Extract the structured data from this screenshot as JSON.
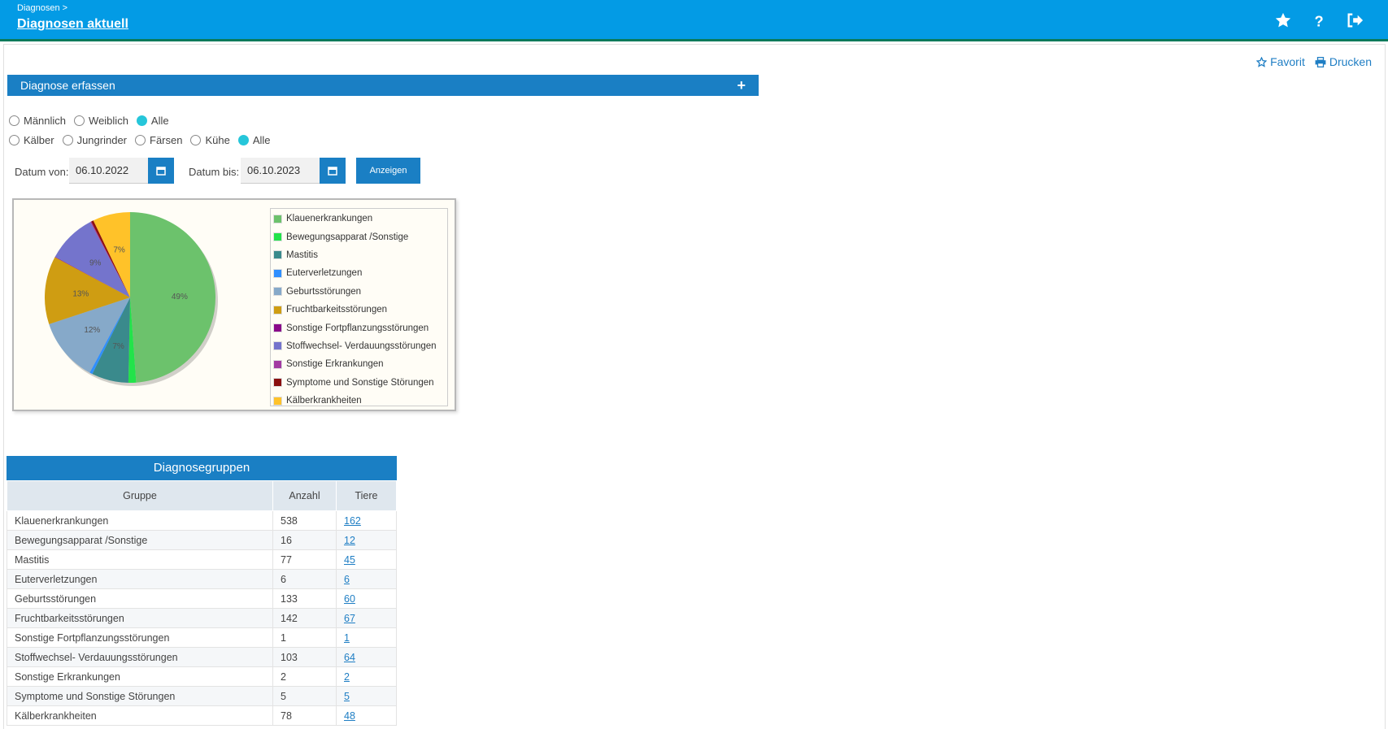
{
  "header": {
    "breadcrumb": "Diagnosen >",
    "title": "Diagnosen aktuell"
  },
  "actions": {
    "favorite": "Favorit",
    "print": "Drucken"
  },
  "panel": {
    "title": "Diagnose erfassen"
  },
  "filters": {
    "sex": [
      {
        "label": "Männlich",
        "checked": false
      },
      {
        "label": "Weiblich",
        "checked": false
      },
      {
        "label": "Alle",
        "checked": true
      }
    ],
    "group": [
      {
        "label": "Kälber",
        "checked": false
      },
      {
        "label": "Jungrinder",
        "checked": false
      },
      {
        "label": "Färsen",
        "checked": false
      },
      {
        "label": "Kühe",
        "checked": false
      },
      {
        "label": "Alle",
        "checked": true
      }
    ]
  },
  "dates": {
    "from_label": "Datum von:",
    "from_value": "06.10.2022",
    "to_label": "Datum bis:",
    "to_value": "06.10.2023",
    "show_button": "Anzeigen"
  },
  "chart_data": {
    "type": "pie",
    "categories": [
      "Klauenerkrankungen",
      "Bewegungsapparat /Sonstige",
      "Mastitis",
      "Euterverletzungen",
      "Geburtsstörungen",
      "Fruchtbarkeitsstörungen",
      "Sonstige Fortpflanzungsstörungen",
      "Stoffwechsel- Verdauungsstörungen",
      "Sonstige Erkrankungen",
      "Symptome und Sonstige Störungen",
      "Kälberkrankheiten"
    ],
    "values": [
      538,
      16,
      77,
      6,
      133,
      142,
      1,
      103,
      2,
      5,
      78
    ],
    "colors": [
      "#6cc26c",
      "#22e34a",
      "#3a8a8c",
      "#2f8fff",
      "#86a9c9",
      "#cf9d12",
      "#8a0a8a",
      "#7474cc",
      "#a23aa2",
      "#8a1010",
      "#ffc229"
    ],
    "data_labels": [
      "49%",
      "",
      "7%",
      "",
      "12%",
      "13%",
      "",
      "9%",
      "",
      "",
      "7%"
    ],
    "legend_position": "right"
  },
  "table": {
    "title": "Diagnosegruppen",
    "headers": [
      "Gruppe",
      "Anzahl",
      "Tiere"
    ],
    "rows": [
      [
        "Klauenerkrankungen",
        "538",
        "162"
      ],
      [
        "Bewegungsapparat /Sonstige",
        "16",
        "12"
      ],
      [
        "Mastitis",
        "77",
        "45"
      ],
      [
        "Euterverletzungen",
        "6",
        "6"
      ],
      [
        "Geburtsstörungen",
        "133",
        "60"
      ],
      [
        "Fruchtbarkeitsstörungen",
        "142",
        "67"
      ],
      [
        "Sonstige Fortpflanzungsstörungen",
        "1",
        "1"
      ],
      [
        "Stoffwechsel- Verdauungsstörungen",
        "103",
        "64"
      ],
      [
        "Sonstige Erkrankungen",
        "2",
        "2"
      ],
      [
        "Symptome und Sonstige Störungen",
        "5",
        "5"
      ],
      [
        "Kälberkrankheiten",
        "78",
        "48"
      ]
    ]
  }
}
